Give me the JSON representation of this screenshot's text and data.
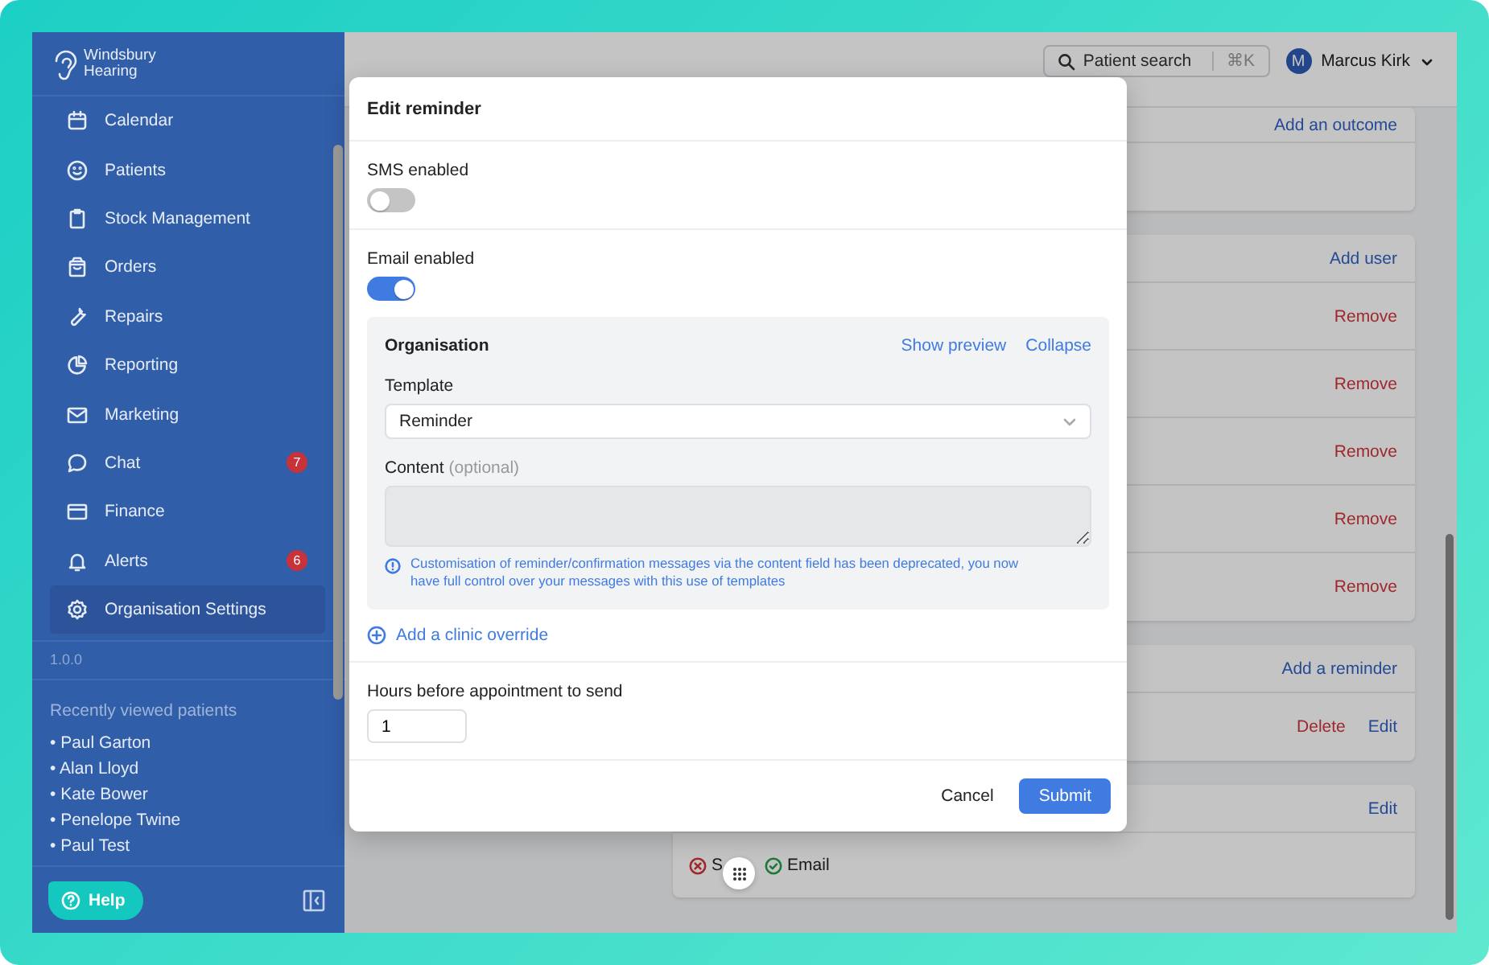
{
  "sidebar": {
    "brand_lines": [
      "Windsbury",
      "Hearing"
    ],
    "nav_items": [
      {
        "label": "Calendar",
        "selected": false
      },
      {
        "label": "Patients",
        "selected": false
      },
      {
        "label": "Stock Management",
        "selected": false
      },
      {
        "label": "Orders",
        "selected": false
      },
      {
        "label": "Repairs",
        "selected": false
      },
      {
        "label": "Reporting",
        "selected": false
      },
      {
        "label": "Marketing",
        "selected": false
      },
      {
        "label": "Chat",
        "badge": "7",
        "selected": false
      },
      {
        "label": "Finance",
        "selected": false
      },
      {
        "label": "Alerts",
        "badge": "6",
        "selected": false
      },
      {
        "label": "Organisation Settings",
        "selected": true
      }
    ],
    "version": "1.0.0",
    "recent_title": "Recently viewed patients",
    "recent_patients": [
      "• Paul Garton",
      "• Alan Lloyd",
      "• Kate Bower",
      "• Penelope Twine",
      "• Paul Test"
    ],
    "help_button": "Help"
  },
  "topbar": {
    "search": {
      "placeholder": "Patient search",
      "shortcut": "⌘K"
    },
    "user": {
      "initial": "M",
      "name": "Marcus Kirk"
    }
  },
  "cards": [
    {
      "header_actions": [
        {
          "label": "Add an outcome",
          "kind": "link"
        }
      ],
      "rows": [
        {
          "actions": []
        }
      ]
    },
    {
      "header_actions": [
        {
          "label": "Add user",
          "kind": "link"
        }
      ],
      "rows": [
        {
          "actions": [
            {
              "label": "Remove",
              "kind": "danger"
            }
          ]
        },
        {
          "actions": [
            {
              "label": "Remove",
              "kind": "danger"
            }
          ]
        },
        {
          "actions": [
            {
              "label": "Remove",
              "kind": "danger"
            }
          ]
        },
        {
          "actions": [
            {
              "label": "Remove",
              "kind": "danger"
            }
          ]
        },
        {
          "actions": [
            {
              "label": "Remove",
              "kind": "danger"
            }
          ]
        }
      ]
    },
    {
      "header_actions": [
        {
          "label": "Add a reminder",
          "kind": "link"
        }
      ],
      "rows": [
        {
          "actions": [
            {
              "label": "Delete",
              "kind": "danger"
            },
            {
              "label": "Edit",
              "kind": "link"
            }
          ]
        }
      ]
    },
    {
      "header_actions": [
        {
          "label": "Edit",
          "kind": "link"
        }
      ],
      "rows": [
        {
          "statuses": [
            {
              "label": "S",
              "enabled": false
            },
            {
              "label": "Email",
              "enabled": true
            }
          ]
        }
      ]
    }
  ],
  "modal": {
    "title": "Edit reminder",
    "toggles": [
      {
        "label": "SMS enabled",
        "on": false
      },
      {
        "label": "Email enabled",
        "on": true
      }
    ],
    "panel": {
      "title": "Organisation",
      "links": [
        "Show preview",
        "Collapse"
      ],
      "template_label": "Template",
      "template_value": "Reminder",
      "content_label": "Content",
      "content_hint": "(optional)",
      "content_disabled": true,
      "info": "Customisation of reminder/confirmation messages via the content field has been deprecated, you now have full control over your messages with this use of templates"
    },
    "add_override": "Add a clinic override",
    "hours_label": "Hours before appointment to send",
    "hours_value": "1",
    "cancel": "Cancel",
    "submit": "Submit"
  }
}
